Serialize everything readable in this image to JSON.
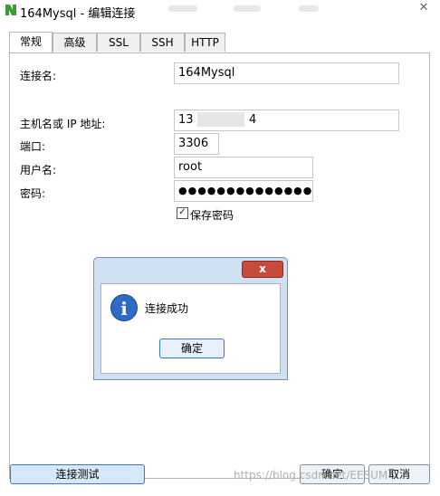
{
  "window": {
    "title": "164Mysql - 编辑连接",
    "close_glyph": "✕",
    "app_icon": "navicat-icon"
  },
  "tabs": [
    {
      "label": "常规",
      "active": true
    },
    {
      "label": "高级",
      "active": false
    },
    {
      "label": "SSL",
      "active": false
    },
    {
      "label": "SSH",
      "active": false
    },
    {
      "label": "HTTP",
      "active": false
    }
  ],
  "form": {
    "connection_name_label": "连接名:",
    "connection_name_value": "164Mysql",
    "host_label": "主机名或 IP 地址:",
    "host_value_start": "13",
    "host_value_end": "4",
    "port_label": "端口:",
    "port_value": "3306",
    "user_label": "用户名:",
    "user_value": "root",
    "password_label": "密码:",
    "password_value": "●●●●●●●●●●●●●●",
    "save_password_label": "保存密码",
    "save_password_checked": true,
    "checkbox_glyph": "✓"
  },
  "message_box": {
    "icon": "info-icon",
    "icon_glyph": "i",
    "close_glyph": "x",
    "text": "连接成功",
    "ok_label": "确定"
  },
  "buttons": {
    "test_label": "连接测试",
    "ok_label": "确定",
    "cancel_label": "取消"
  },
  "watermark": "https://blog.csdn.net/EESUM",
  "colors": {
    "accent": "#3a78c4",
    "close_red": "#c84a3c",
    "info_blue": "#2e6bc4"
  }
}
